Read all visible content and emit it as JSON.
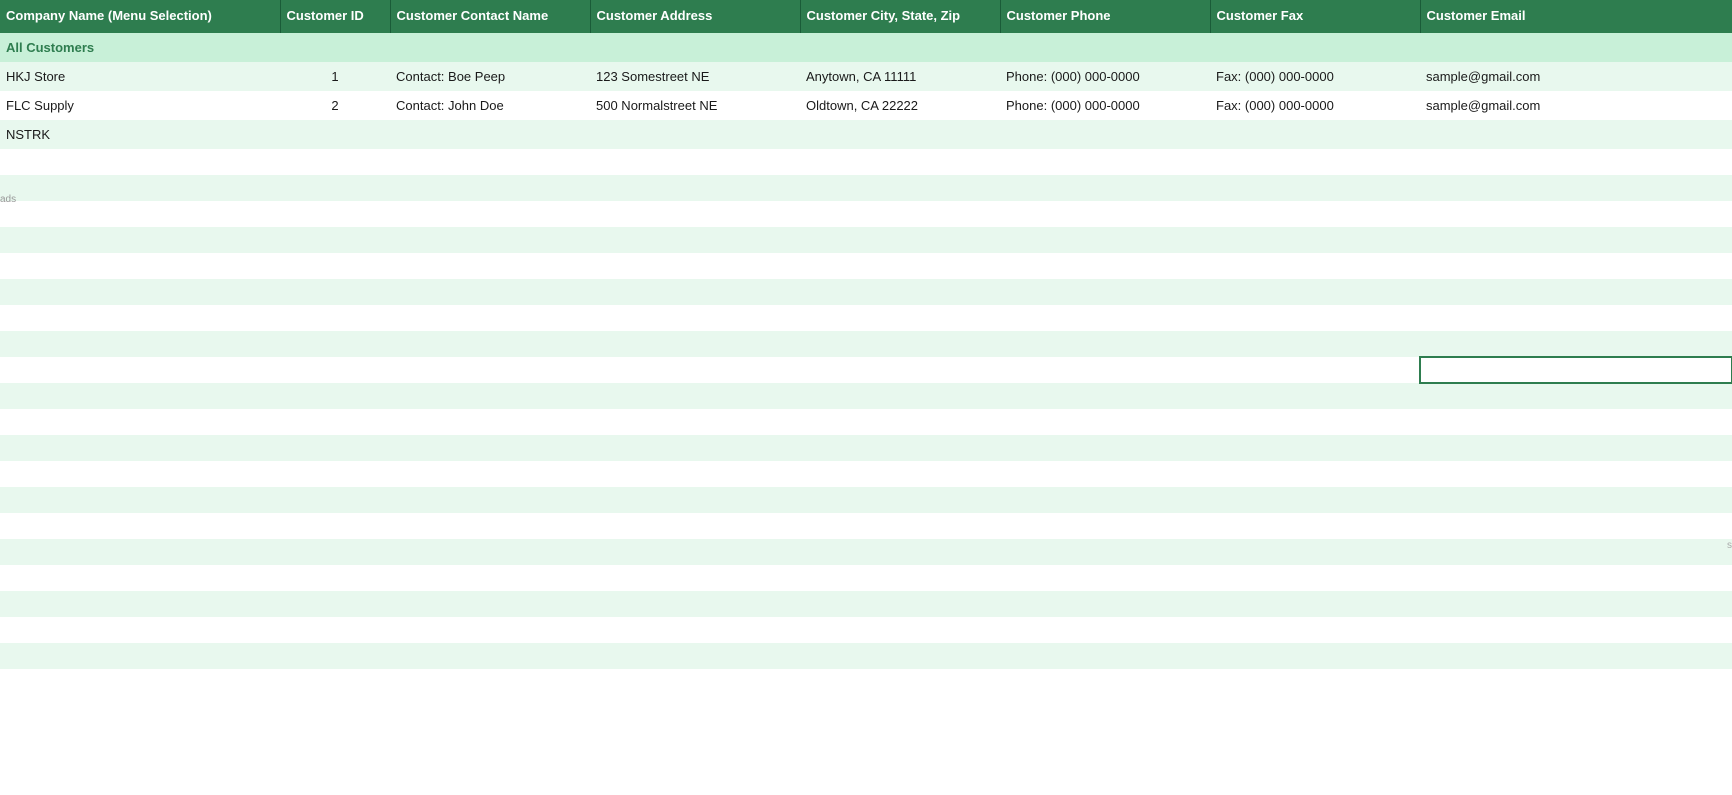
{
  "table": {
    "columns": [
      {
        "key": "company",
        "label": "Company Name (Menu Selection)"
      },
      {
        "key": "id",
        "label": "Customer ID"
      },
      {
        "key": "contact",
        "label": "Customer Contact Name"
      },
      {
        "key": "address",
        "label": "Customer Address"
      },
      {
        "key": "city_state_zip",
        "label": "Customer City, State, Zip"
      },
      {
        "key": "phone",
        "label": "Customer Phone"
      },
      {
        "key": "fax",
        "label": "Customer Fax"
      },
      {
        "key": "email",
        "label": "Customer Email"
      }
    ],
    "special_row": {
      "company": "All Customers",
      "id": "",
      "contact": "",
      "address": "",
      "city_state_zip": "",
      "phone": "",
      "fax": "",
      "email": ""
    },
    "rows": [
      {
        "company": "HKJ Store",
        "id": "1",
        "contact": "Contact: Boe Peep",
        "address": "123 Somestreet NE",
        "city_state_zip": "Anytown, CA 11111",
        "phone": "Phone: (000) 000-0000",
        "fax": "Fax: (000) 000-0000",
        "email": "sample@gmail.com"
      },
      {
        "company": "FLC Supply",
        "id": "2",
        "contact": "Contact: John Doe",
        "address": "500 Normalstreet NE",
        "city_state_zip": "Oldtown, CA 22222",
        "phone": "Phone: (000) 000-0000",
        "fax": "Fax: (000) 000-0000",
        "email": "sample@gmail.com"
      },
      {
        "company": "NSTRK",
        "id": "",
        "contact": "",
        "address": "",
        "city_state_zip": "",
        "phone": "",
        "fax": "",
        "email": ""
      }
    ],
    "empty_row_count": 25
  },
  "colors": {
    "header_bg": "#2e7d4f",
    "header_text": "#ffffff",
    "all_customers_bg": "#c8f0d8",
    "all_customers_text": "#2e7d4f",
    "stripe_even": "#e8f8ee",
    "stripe_odd": "#ffffff",
    "selected_cell_border": "#2e7d4f"
  }
}
